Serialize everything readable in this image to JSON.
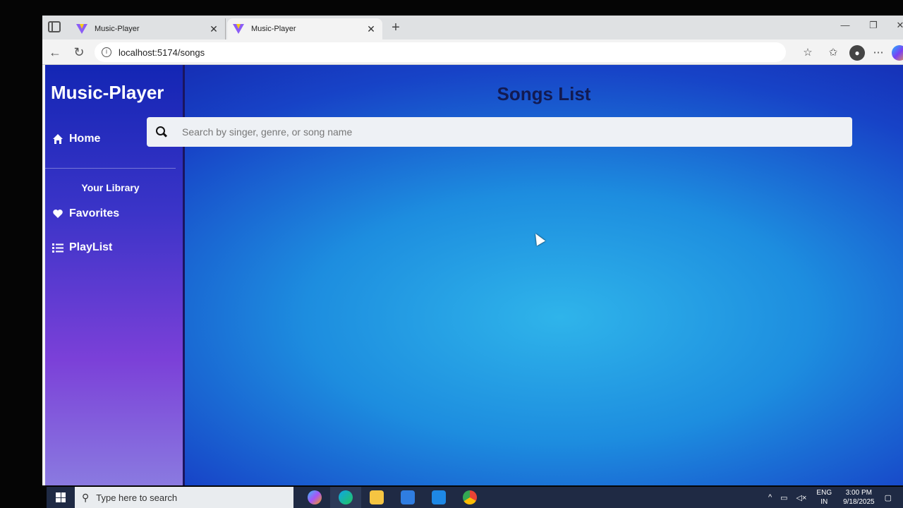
{
  "browser": {
    "tabs": [
      {
        "title": "Music-Player",
        "close": "✕"
      },
      {
        "title": "Music-Player",
        "close": "✕"
      }
    ],
    "new_tab": "+",
    "url": "localhost:5174/songs"
  },
  "app": {
    "brand": "Music-Player",
    "nav": {
      "home": "Home",
      "library_label": "Your Library",
      "favorites": "Favorites",
      "playlist": "PlayList"
    },
    "heading": "Songs List",
    "search": {
      "placeholder": "Search by singer, genre, or song name",
      "value": ""
    }
  },
  "taskbar": {
    "search_placeholder": "Type here to search",
    "lang_top": "ENG",
    "lang_bottom": "IN",
    "time": "3:00 PM",
    "date": "9/18/2025"
  },
  "colors": {
    "sidebar_top": "#1326b4",
    "sidebar_bottom": "#8a7ae0",
    "main_center": "#2fb4ea",
    "heading": "#121a52"
  }
}
